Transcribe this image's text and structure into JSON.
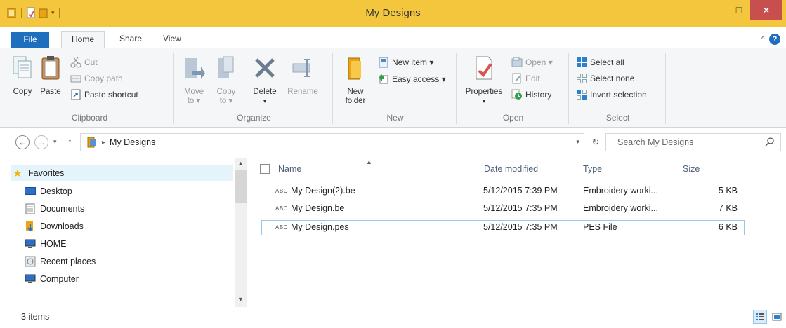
{
  "window": {
    "title": "My Designs",
    "minimize": "–",
    "maximize": "□",
    "close": "×"
  },
  "ribbon_tabs": {
    "file": "File",
    "home": "Home",
    "share": "Share",
    "view": "View",
    "collapse": "^",
    "help": "?"
  },
  "clipboard": {
    "copy": "Copy",
    "paste": "Paste",
    "cut": "Cut",
    "copy_path": "Copy path",
    "paste_shortcut": "Paste shortcut",
    "label": "Clipboard"
  },
  "organize": {
    "move_to": "Move",
    "move_to2": "to",
    "copy_to": "Copy",
    "copy_to2": "to",
    "delete": "Delete",
    "rename": "Rename",
    "label": "Organize"
  },
  "new_group": {
    "new_folder": "New",
    "new_folder2": "folder",
    "new_item": "New item ▾",
    "easy_access": "Easy access ▾",
    "label": "New"
  },
  "open_group": {
    "properties": "Properties",
    "open": "Open ▾",
    "edit": "Edit",
    "history": "History",
    "label": "Open"
  },
  "select_group": {
    "select_all": "Select all",
    "select_none": "Select none",
    "invert_selection": "Invert selection",
    "label": "Select"
  },
  "address": {
    "back": "←",
    "forward": "→",
    "up": "↑",
    "path": "My Designs",
    "search_placeholder": "Search My Designs"
  },
  "nav_pane": {
    "items": [
      {
        "label": "Favorites"
      },
      {
        "label": "Desktop"
      },
      {
        "label": "Documents"
      },
      {
        "label": "Downloads"
      },
      {
        "label": "HOME"
      },
      {
        "label": "Recent places"
      },
      {
        "label": "Computer"
      }
    ]
  },
  "file_list": {
    "columns": {
      "name": "Name",
      "date_modified": "Date modified",
      "type": "Type",
      "size": "Size"
    },
    "rows": [
      {
        "name": "My Design(2).be",
        "date": "5/12/2015 7:39 PM",
        "type": "Embroidery worki...",
        "size": "5 KB"
      },
      {
        "name": "My Design.be",
        "date": "5/12/2015 7:35 PM",
        "type": "Embroidery worki...",
        "size": "7 KB"
      },
      {
        "name": "My Design.pes",
        "date": "5/12/2015 7:35 PM",
        "type": "PES File",
        "size": "6 KB"
      }
    ],
    "file_icon_label": "ABC"
  },
  "status": {
    "item_count": "3 items"
  },
  "colors": {
    "titlebar": "#f4c63d",
    "file_tab": "#1f6fbf",
    "close_button": "#c7504f",
    "selection_border": "#99c7e8"
  }
}
